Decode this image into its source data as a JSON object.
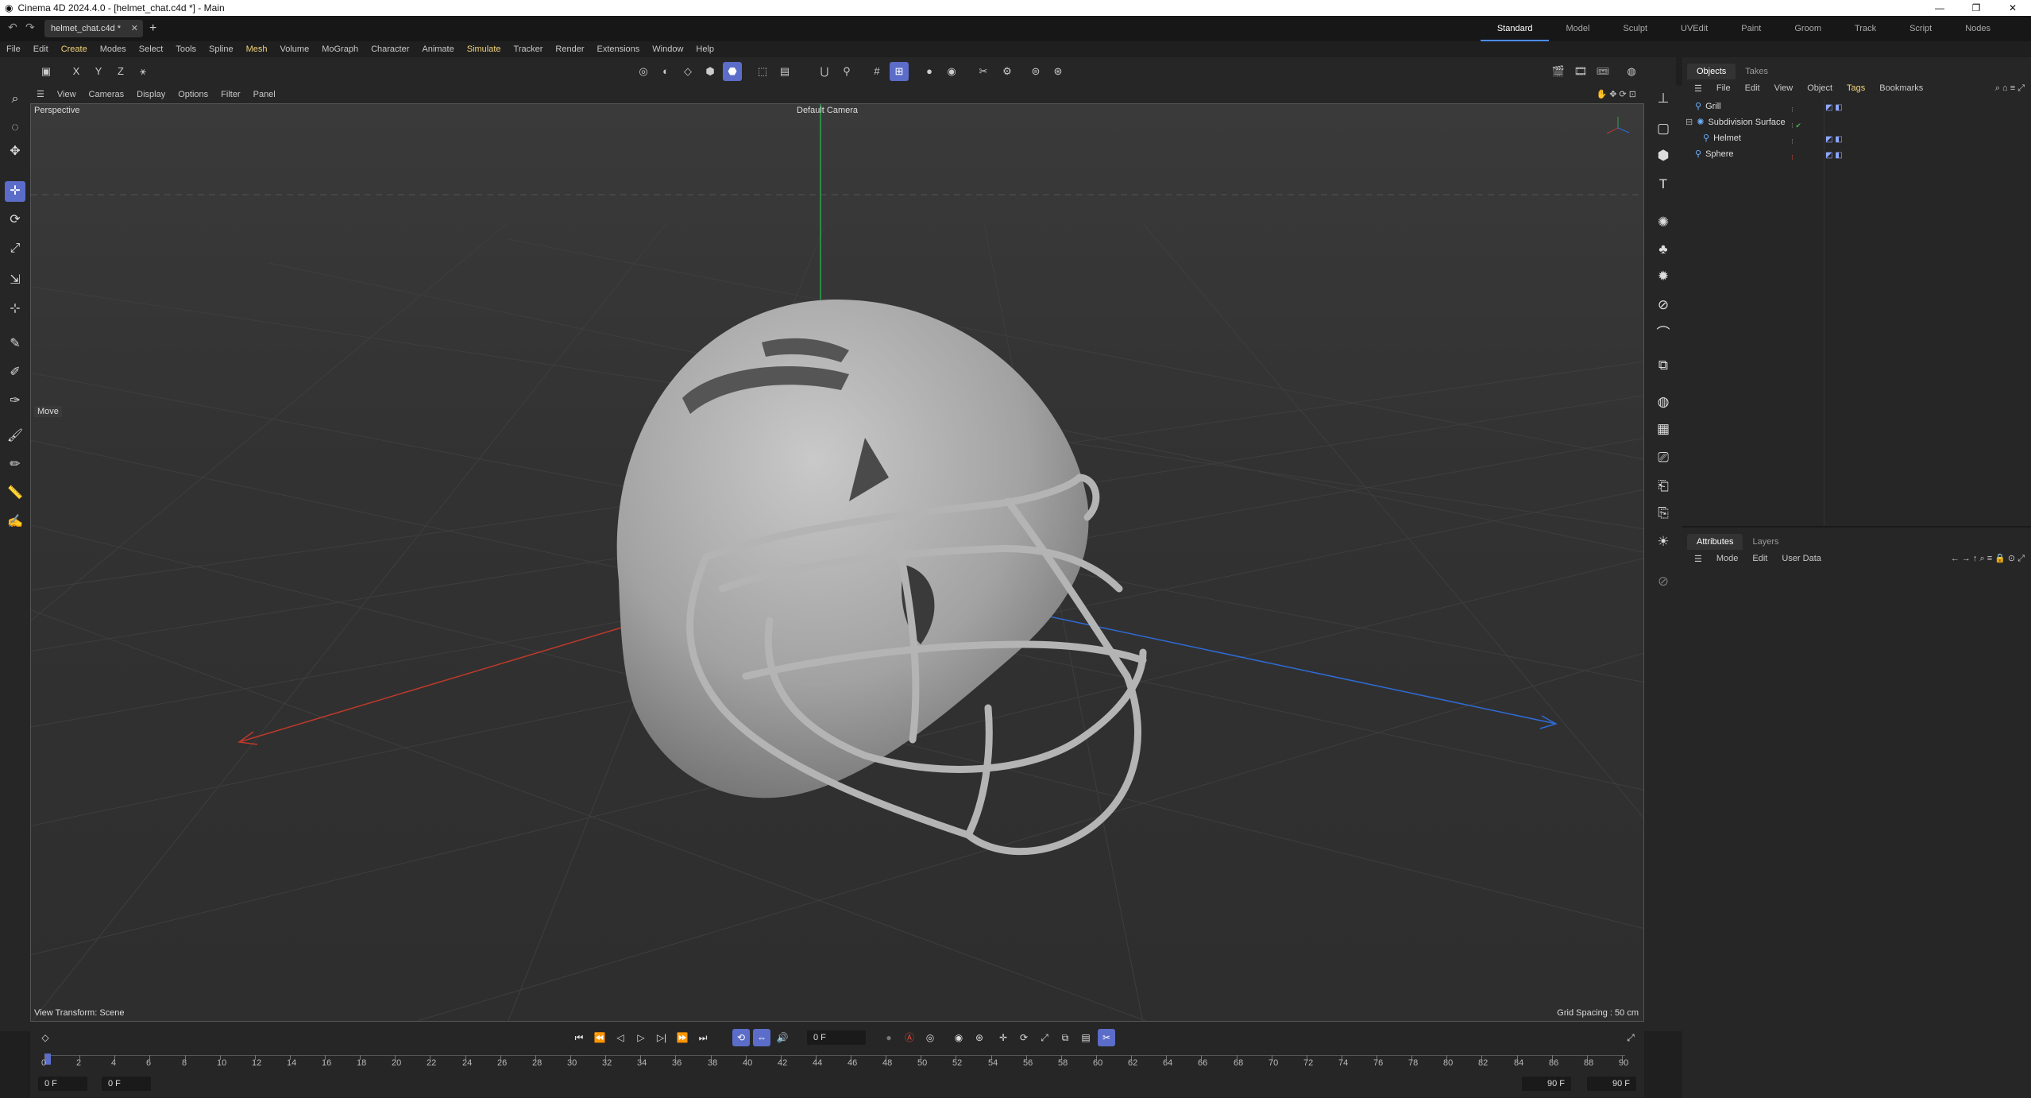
{
  "app": {
    "window_title": "Cinema 4D 2024.4.0 - [helmet_chat.c4d *] - Main",
    "document_tab": "helmet_chat.c4d *",
    "window_buttons": [
      "—",
      "❐",
      "✕"
    ]
  },
  "layouts": [
    "Standard",
    "Model",
    "Sculpt",
    "UVEdit",
    "Paint",
    "Groom",
    "Track",
    "Script",
    "Nodes"
  ],
  "menu": [
    "File",
    "Edit",
    "Create",
    "Modes",
    "Select",
    "Tools",
    "Spline",
    "Mesh",
    "Volume",
    "MoGraph",
    "Character",
    "Animate",
    "Simulate",
    "Tracker",
    "Render",
    "Extensions",
    "Window",
    "Help"
  ],
  "axis_lock": [
    "X",
    "Y",
    "Z"
  ],
  "viewport": {
    "menu": [
      "View",
      "Cameras",
      "Display",
      "Options",
      "Filter",
      "Panel"
    ],
    "projection": "Perspective",
    "camera": "Default Camera",
    "tool_label": "Move",
    "view_transform": "View Transform: Scene",
    "grid_spacing": "Grid Spacing : 50 cm"
  },
  "objects_panel": {
    "tabs": [
      "Objects",
      "Takes"
    ],
    "menu": [
      "File",
      "Edit",
      "View",
      "Object",
      "Tags",
      "Bookmarks"
    ],
    "items": [
      {
        "name": "Grill"
      },
      {
        "name": "Subdivision Surface"
      },
      {
        "name": "Helmet"
      },
      {
        "name": "Sphere"
      }
    ]
  },
  "attributes_panel": {
    "tabs": [
      "Attributes",
      "Layers"
    ],
    "menu": [
      "Mode",
      "Edit",
      "User Data"
    ]
  },
  "timeline": {
    "current_frame": "0 F",
    "start_frame": "0 F",
    "preview_start": "0 F",
    "preview_end": "90 F",
    "end_frame": "90 F",
    "ticks": [
      "0",
      "2",
      "4",
      "6",
      "8",
      "10",
      "12",
      "14",
      "16",
      "18",
      "20",
      "22",
      "24",
      "26",
      "28",
      "30",
      "32",
      "34",
      "36",
      "38",
      "40",
      "42",
      "44",
      "46",
      "48",
      "50",
      "52",
      "54",
      "56",
      "58",
      "60",
      "62",
      "64",
      "66",
      "68",
      "70",
      "72",
      "74",
      "76",
      "78",
      "80",
      "82",
      "84",
      "86",
      "88",
      "90"
    ]
  },
  "colors": {
    "accent": "#5b6dc9",
    "x_axis": "#c0392b",
    "y_axis": "#27ae60",
    "z_axis": "#2e6bd6",
    "menu_highlight": "#f2d47a"
  }
}
